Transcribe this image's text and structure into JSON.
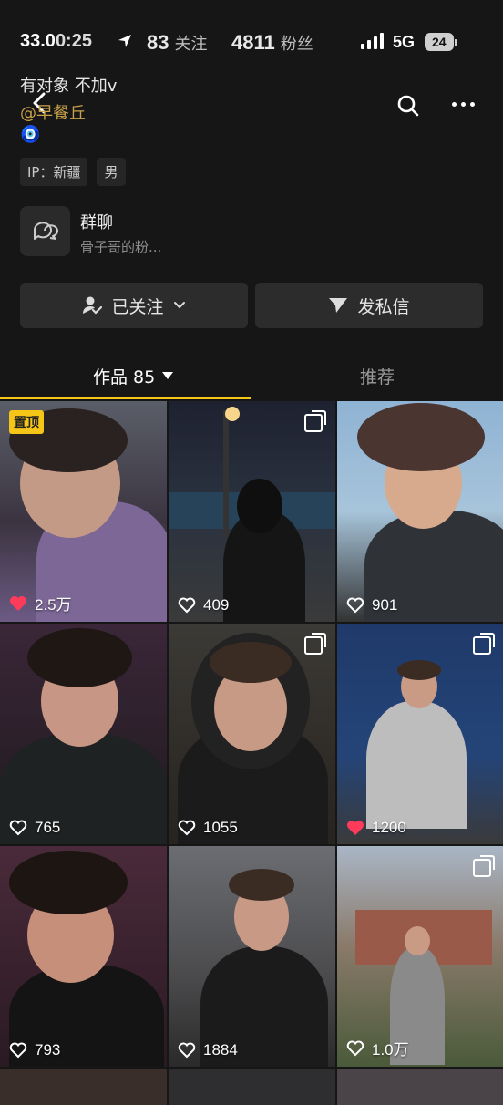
{
  "status_bar": {
    "time": "33.0",
    "time_suffix": "0:25",
    "network": "5G",
    "battery": "24"
  },
  "stats": [
    {
      "value": "83",
      "label": "关注"
    },
    {
      "value": "4811",
      "label": "粉丝"
    }
  ],
  "profile": {
    "bio": "有对象 不加v",
    "mention": "@早餐丘",
    "emoji": "🧿",
    "tags": [
      "IP：新疆",
      "男"
    ]
  },
  "group_chat": {
    "title": "群聊",
    "subtitle": "骨子哥的粉..."
  },
  "actions": {
    "followed_label": "已关注",
    "message_label": "发私信"
  },
  "tabs": {
    "works_label": "作品 85",
    "recommend_label": "推荐"
  },
  "pinned_label": "置顶",
  "grid_likes": [
    "2.5万",
    "409",
    "901",
    "765",
    "1055",
    "1200",
    "793",
    "1884",
    "1.0万"
  ],
  "colors": {
    "accent_yellow": "#f5c518",
    "like_red": "#ff3b5c",
    "background": "#161616"
  }
}
